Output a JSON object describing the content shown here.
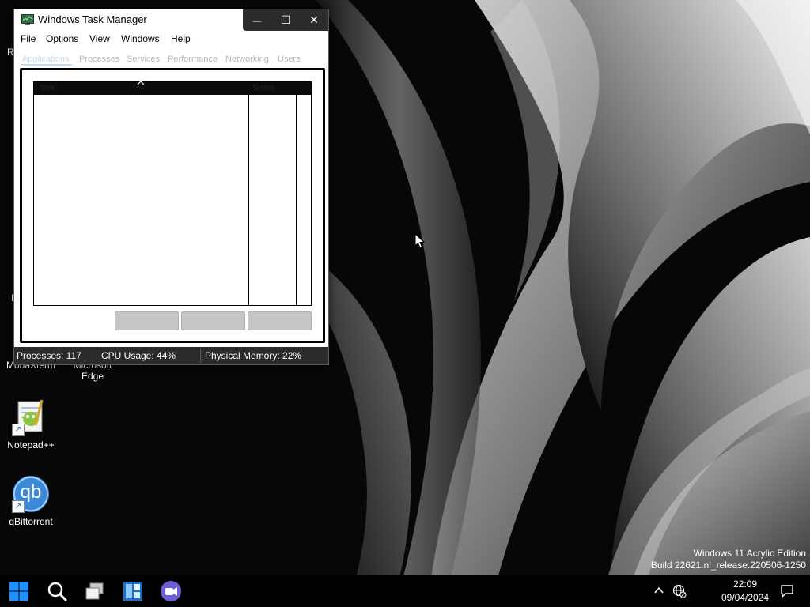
{
  "desktop": {
    "icons": [
      {
        "label": "MobaXterm"
      },
      {
        "label": "Microsoft Edge"
      },
      {
        "label": "Notepad++"
      },
      {
        "label": "qBittorrent",
        "glyph": "qb"
      }
    ],
    "partial_labels": [
      "R",
      "D"
    ]
  },
  "task_manager": {
    "title": "Windows Task Manager",
    "caption_buttons": {
      "minimize": "—",
      "maximize": "☐",
      "close": "✕"
    },
    "menu": [
      "File",
      "Options",
      "View",
      "Windows",
      "Help"
    ],
    "tabs": [
      {
        "label": "Applications",
        "active": true
      },
      {
        "label": "Processes"
      },
      {
        "label": "Services"
      },
      {
        "label": "Performance"
      },
      {
        "label": "Networking"
      },
      {
        "label": "Users"
      }
    ],
    "list_columns": [
      "Task",
      "Status"
    ],
    "status_bar": {
      "processes": "Processes: 117",
      "cpu": "CPU Usage: 44%",
      "memory": "Physical Memory: 22%"
    }
  },
  "watermark": {
    "line1": "Windows 11 Acrylic Edition",
    "line2": "Build 22621.ni_release.220506-1250"
  },
  "taskbar": {
    "buttons": [
      "start-icon",
      "search-icon",
      "task-view-icon",
      "widgets-icon",
      "chat-icon"
    ],
    "clock": {
      "time": "22:09",
      "date": "09/04/2024"
    }
  },
  "colors": {
    "accent_blue": "#0078d4",
    "statusbar": "#2b2b2b",
    "taskbar": "#000000"
  }
}
